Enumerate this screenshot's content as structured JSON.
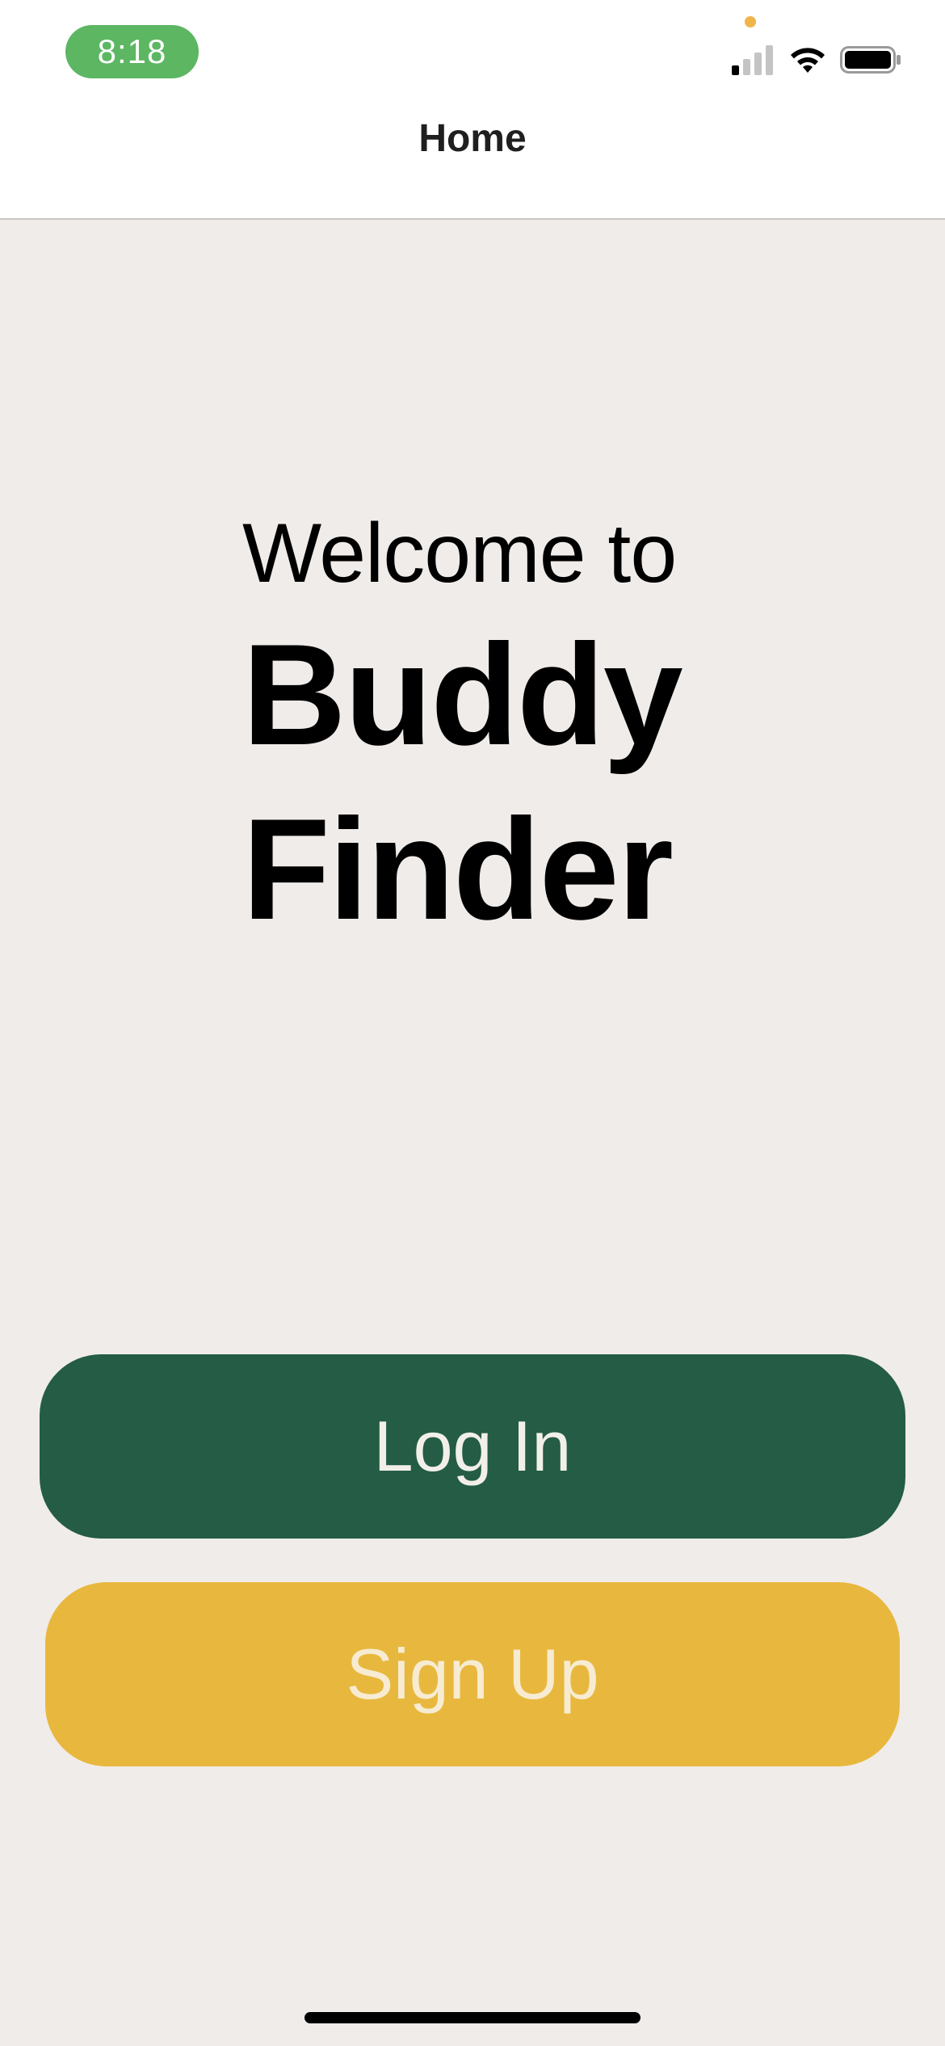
{
  "status_bar": {
    "time": "8:18",
    "colors": {
      "time_pill": "#5cb662",
      "privacy_dot": "#f0b54a"
    },
    "icons": [
      "cellular-signal-icon",
      "wifi-icon",
      "battery-icon"
    ]
  },
  "nav": {
    "title": "Home"
  },
  "welcome": {
    "line1": "Welcome to",
    "app_name_line1": "Buddy",
    "app_name_line2": "Finder"
  },
  "actions": {
    "login_label": "Log In",
    "signup_label": "Sign Up",
    "colors": {
      "login_bg": "#245c45",
      "signup_bg": "#e8b83e",
      "page_bg": "#f0ece9"
    }
  }
}
